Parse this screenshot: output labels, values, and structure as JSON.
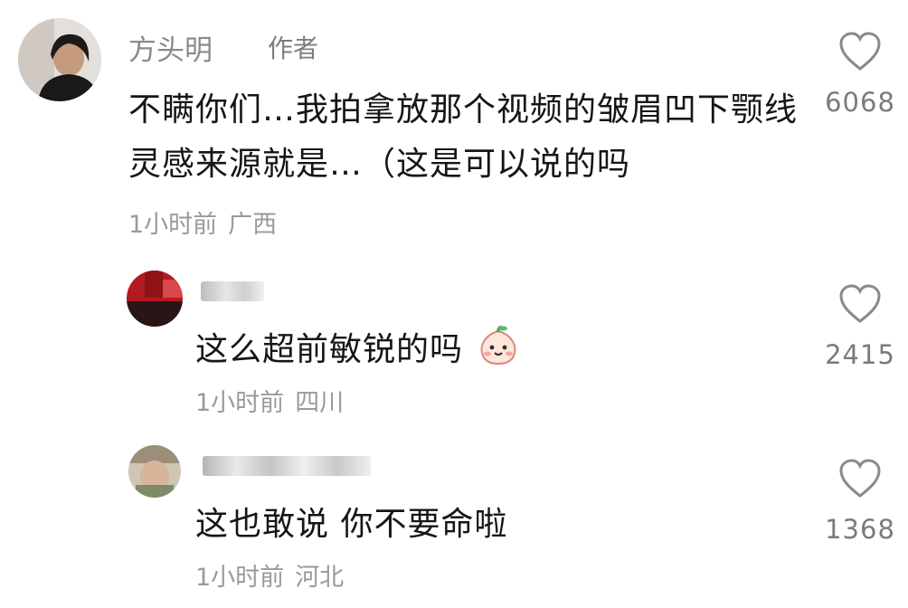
{
  "comments": [
    {
      "username": "方头明",
      "author_tag": "作者",
      "text": "不瞒你们…我拍拿放那个视频的皱眉凹下颚线灵感来源就是…（这是可以说的吗",
      "time": "1小时前",
      "location": "广西",
      "likes": "6068"
    },
    {
      "username": "",
      "text": "这么超前敏锐的吗",
      "emoji": "peach-face-emoji",
      "time": "1小时前",
      "location": "四川",
      "likes": "2415"
    },
    {
      "username": "",
      "text": "这也敢说 你不要命啦",
      "time": "1小时前",
      "location": "河北",
      "likes": "1368"
    }
  ],
  "icons": {
    "like": "heart-outline-icon"
  },
  "colors": {
    "text": "#161616",
    "meta": "#9a9a9a",
    "like_icon": "#8a8a8a"
  }
}
